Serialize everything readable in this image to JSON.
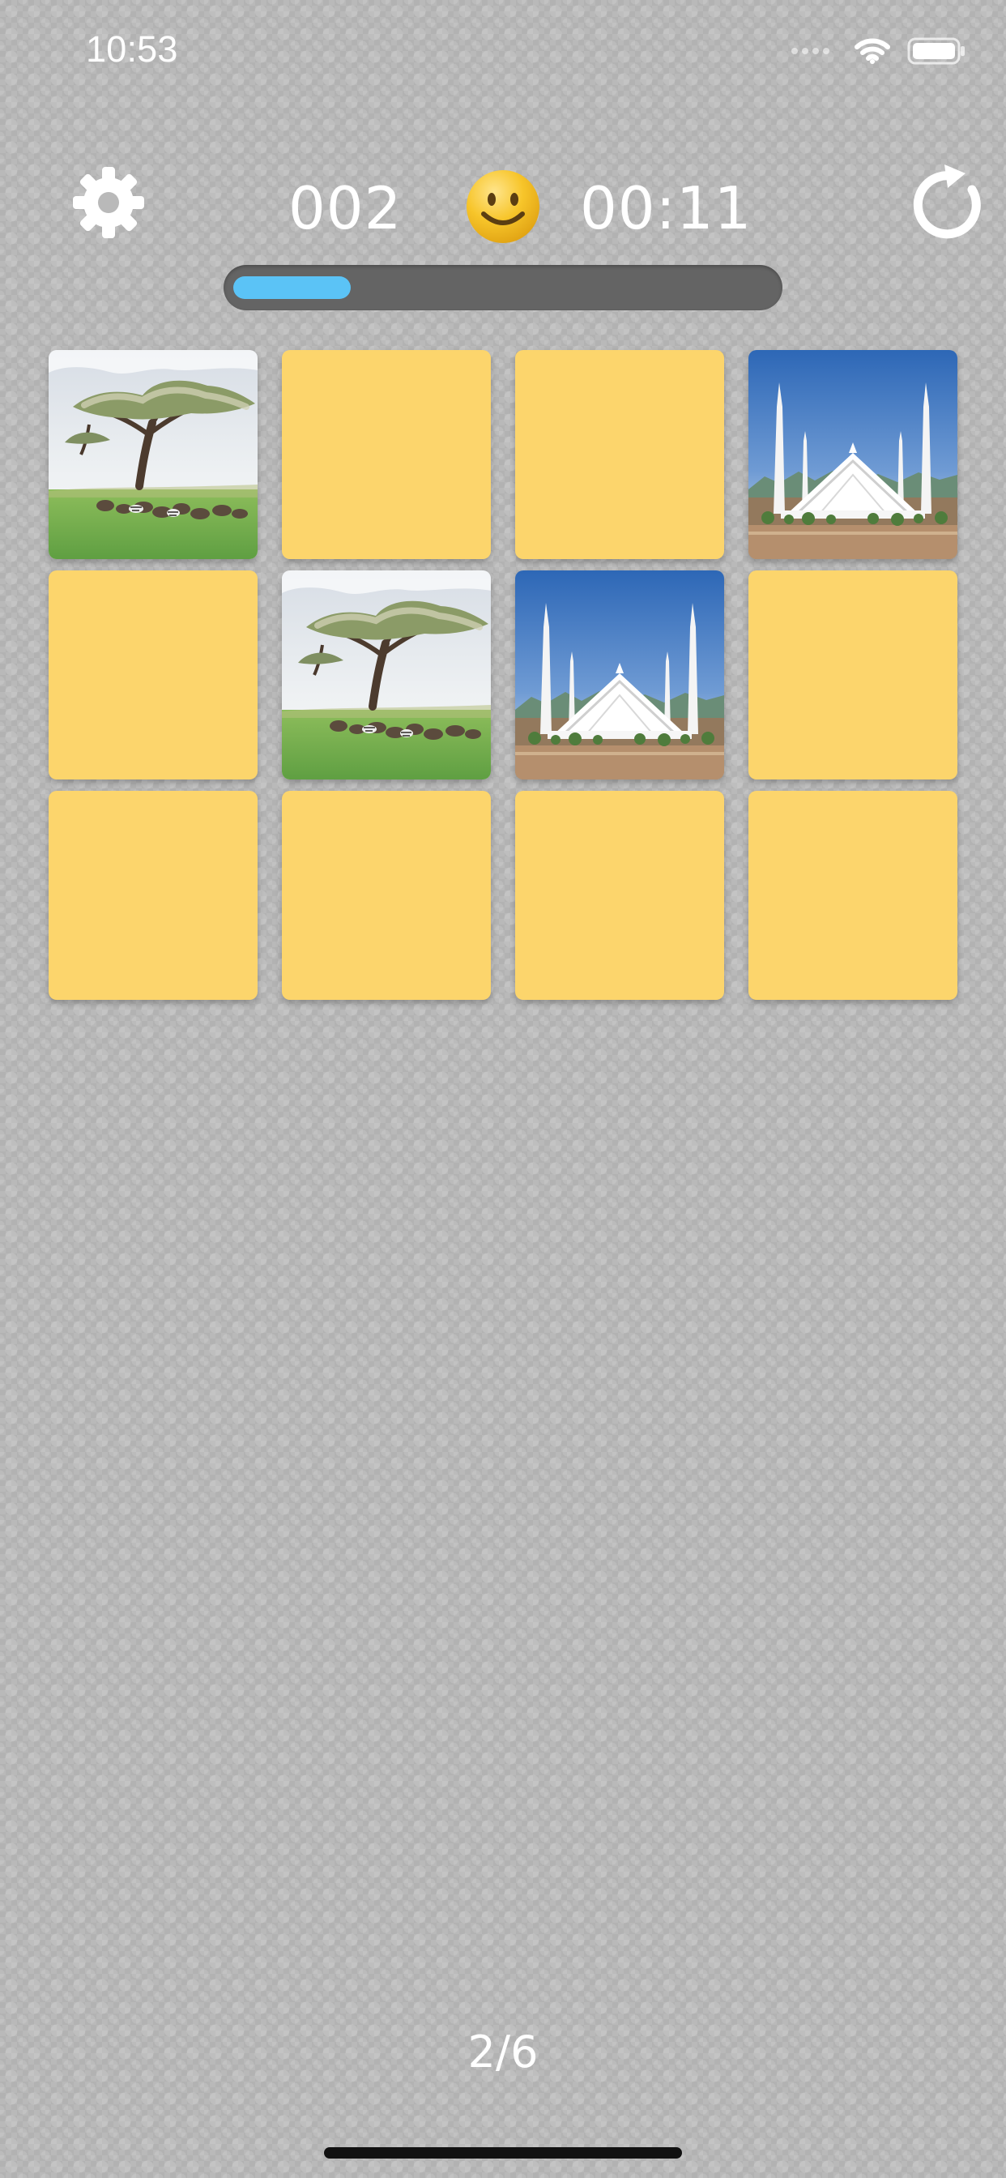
{
  "status_bar": {
    "time": "10:53"
  },
  "header": {
    "moves": "002",
    "timer": "00:11",
    "progress_fraction": 0.217
  },
  "board": {
    "cards": [
      {
        "state": "revealed",
        "image": "acacia-savanna"
      },
      {
        "state": "hidden"
      },
      {
        "state": "hidden"
      },
      {
        "state": "revealed",
        "image": "white-mosque"
      },
      {
        "state": "hidden"
      },
      {
        "state": "revealed",
        "image": "acacia-savanna"
      },
      {
        "state": "revealed",
        "image": "white-mosque"
      },
      {
        "state": "hidden"
      },
      {
        "state": "hidden"
      },
      {
        "state": "hidden"
      },
      {
        "state": "hidden"
      },
      {
        "state": "hidden"
      }
    ]
  },
  "footer": {
    "page": "2/6"
  },
  "colors": {
    "card_back": "#fcd56c",
    "progress_fill": "#5bc3f6",
    "progress_track": "#646464",
    "text": "#ffffff",
    "face": "#f7c52a"
  },
  "icons": {
    "settings": "gear-icon",
    "face": "smiley-icon",
    "restart": "restart-icon",
    "wifi": "wifi-icon",
    "battery": "battery-icon"
  }
}
